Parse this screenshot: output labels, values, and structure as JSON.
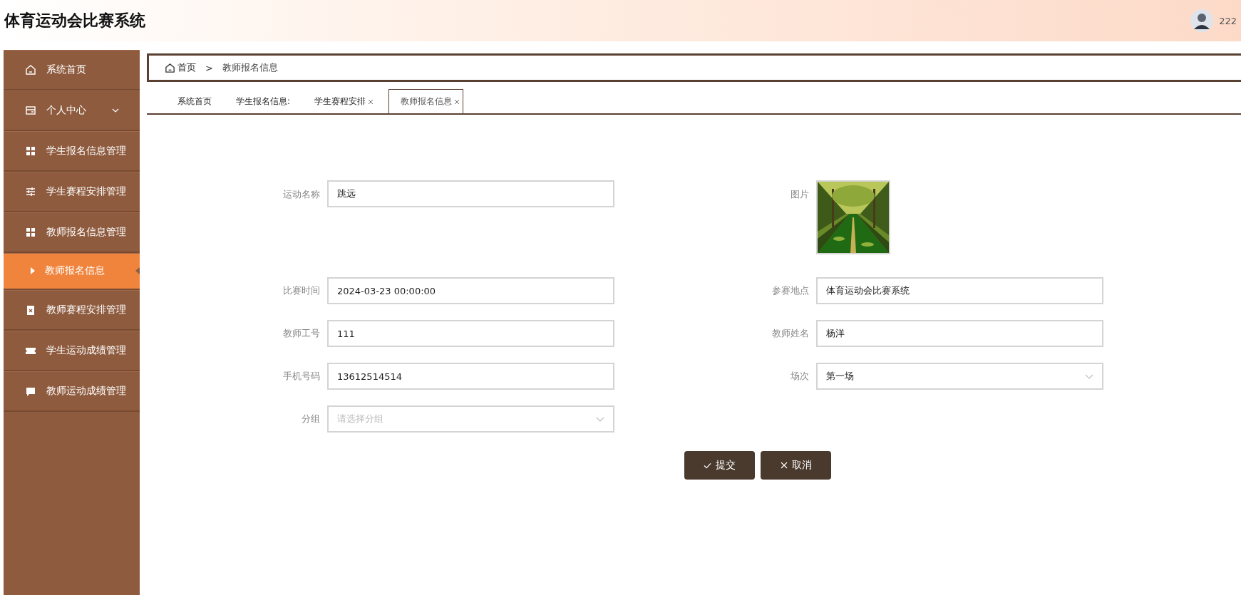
{
  "header": {
    "title": "体育运动会比赛系统",
    "user": "222"
  },
  "sidebar": {
    "items": [
      {
        "label": "系统首页",
        "selected": false
      },
      {
        "label": "个人中心",
        "selected": false,
        "expanded": false
      },
      {
        "label": "学生报名信息管理",
        "selected": false
      },
      {
        "label": "学生赛程安排管理",
        "selected": false
      },
      {
        "label": "教师报名信息管理",
        "selected": false,
        "children": [
          {
            "label": "教师报名信息",
            "selected": true
          }
        ]
      },
      {
        "label": "教师赛程安排管理",
        "selected": false
      },
      {
        "label": "学生运动成绩管理",
        "selected": false
      },
      {
        "label": "教师运动成绩管理",
        "selected": false
      }
    ]
  },
  "breadcrumb": {
    "home": "首页",
    "separator": ">",
    "current": "教师报名信息"
  },
  "tabs": [
    {
      "label": "系统首页",
      "selected": false,
      "closable": false
    },
    {
      "label": "学生报名信息:",
      "selected": false,
      "closable": false
    },
    {
      "label": "学生赛程安排",
      "selected": false,
      "closable": true
    },
    {
      "label": "教师报名信息",
      "selected": true,
      "closable": true
    }
  ],
  "form": {
    "fields": [
      {
        "kind": "text",
        "label": "运动名称",
        "value": "跳远"
      },
      {
        "label": "图片"
      },
      {
        "kind": "text",
        "label": "比赛时间",
        "value": "2024-03-23 00:00:00"
      },
      {
        "kind": "text",
        "label": "参赛地点",
        "value": "体育运动会比赛系统"
      },
      {
        "kind": "text",
        "label": "教师工号",
        "value": "111"
      },
      {
        "kind": "text",
        "label": "教师姓名",
        "value": "杨洋"
      },
      {
        "kind": "text",
        "label": "手机号码",
        "value": "13612514514"
      },
      {
        "kind": "select",
        "label": "场次",
        "value": "第一场"
      },
      {
        "kind": "select",
        "label": "分组",
        "placeholder": "请选择分组"
      }
    ],
    "buttons": [
      {
        "kind": "submit",
        "label": "提交"
      },
      {
        "kind": "cancel",
        "label": "取消"
      }
    ]
  }
}
